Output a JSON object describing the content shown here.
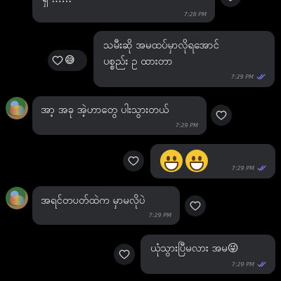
{
  "messages": [
    {
      "id": "m0",
      "dir": "in",
      "text": "ရှ ......",
      "time": "7:28 PM"
    },
    {
      "id": "m1",
      "dir": "out",
      "lines": [
        "သမီးဆို အမထပ်မှာလိုရအောင်",
        "ပစ္စည်း ဥ ထားတာ"
      ],
      "time": "7:29 PM",
      "reaction": "😅"
    },
    {
      "id": "m2",
      "dir": "in",
      "text": "အာ့ အခု အဲ့ဟာတွေ ပါးသွားတယ်",
      "time": "7:29 PM"
    },
    {
      "id": "m3",
      "dir": "out",
      "emoji": "😁😁",
      "time": "7:29 PM"
    },
    {
      "id": "m4",
      "dir": "in",
      "text": "အရင်တပတ်ထဲက မှာမလိုပဲ",
      "time": "7:29 PM"
    },
    {
      "id": "m5",
      "dir": "out",
      "text": "ယုံသွားပြီမလား အမ😜",
      "time": "7:29 PM"
    }
  ],
  "icons": {
    "heart": "heart-outline-icon",
    "read_receipt": "double-check-icon",
    "avatar": "contact-avatar"
  },
  "colors": {
    "background": "#000000",
    "bubble": "#2b2c30",
    "read_tick": "#7b7ff0",
    "meta_text": "#8e8f94"
  }
}
